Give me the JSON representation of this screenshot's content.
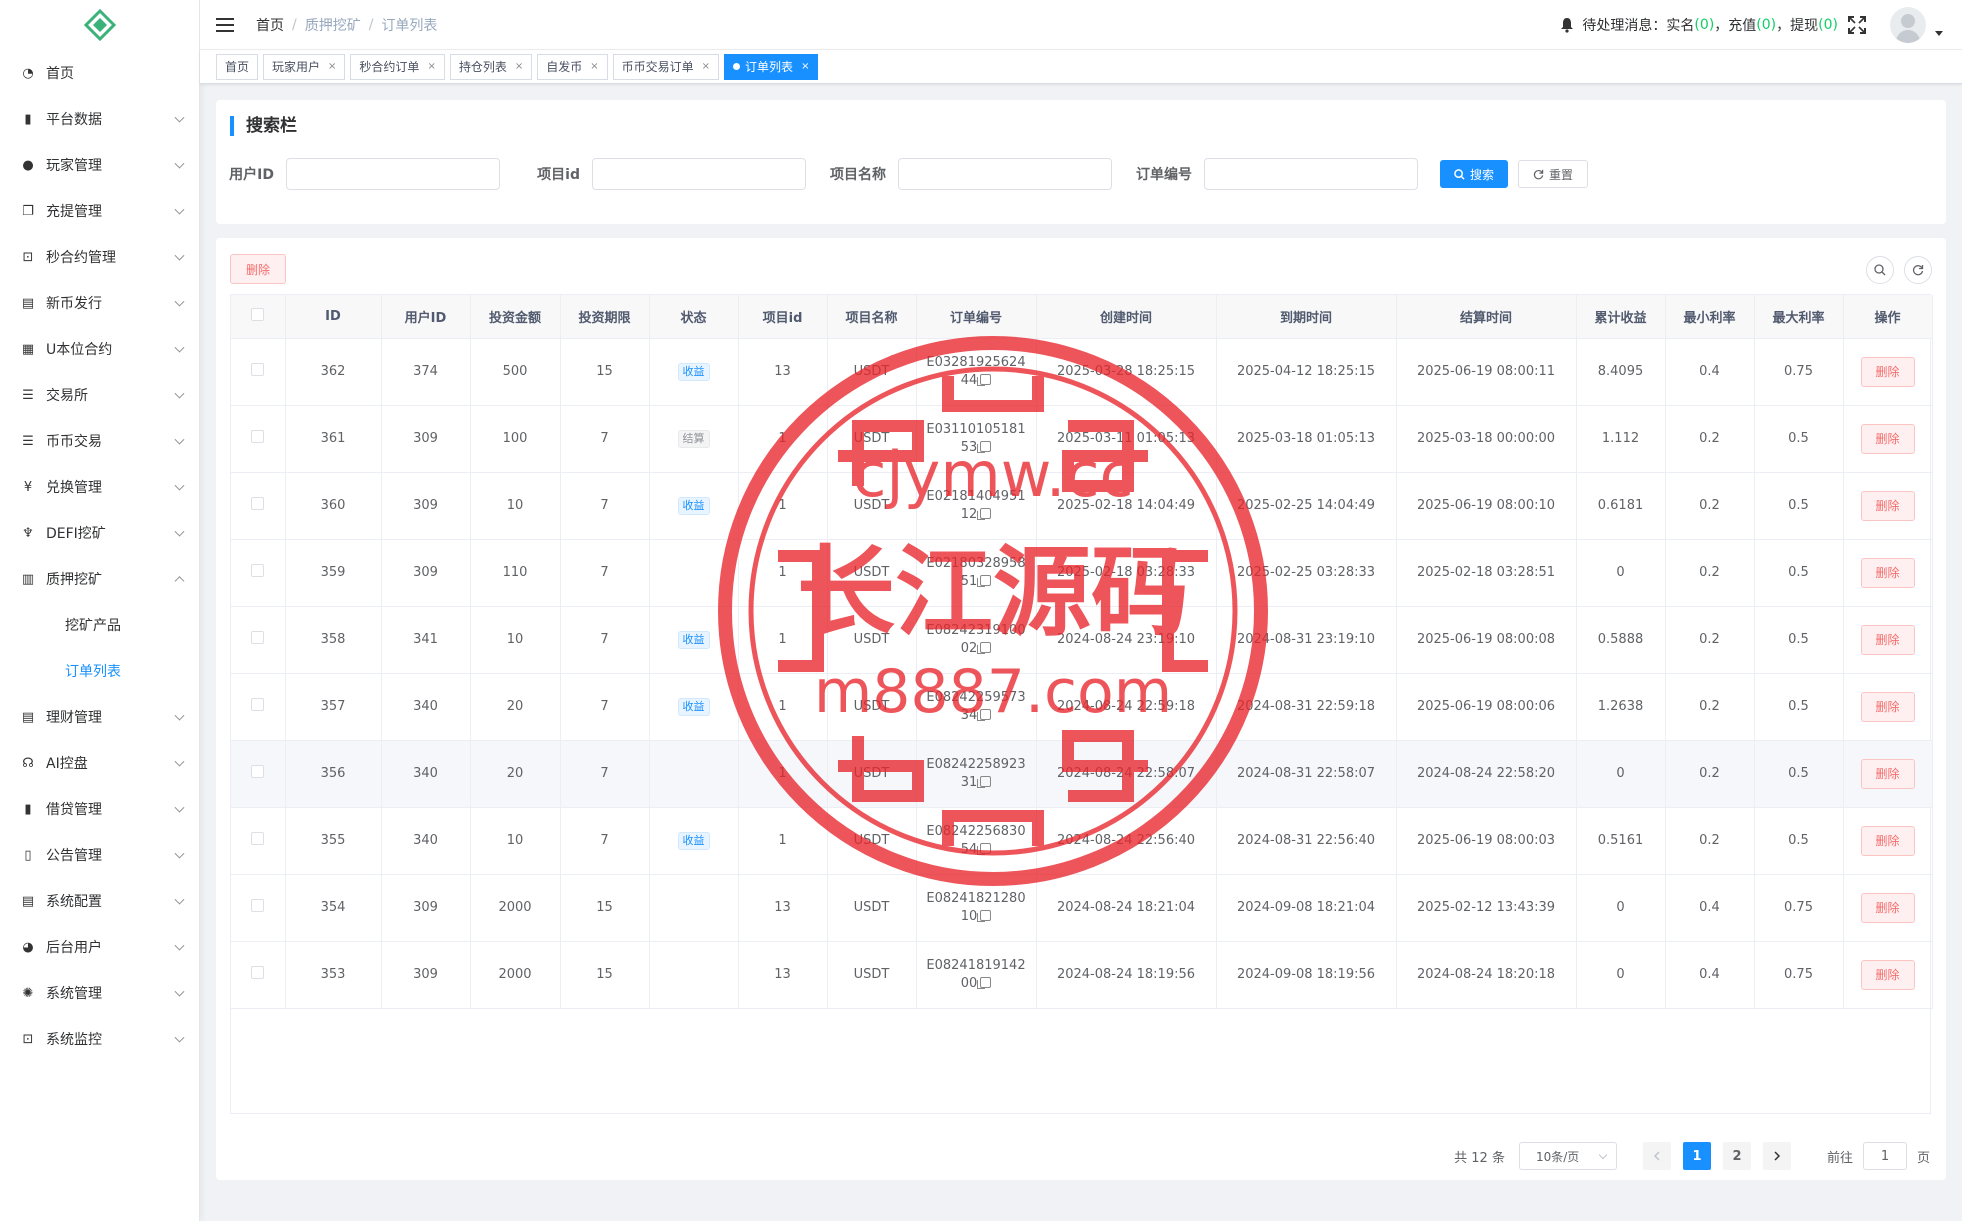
{
  "colors": {
    "primary": "#1890ff",
    "danger": "#f56c6c",
    "success": "#13ce66",
    "watermark": "#e8262c"
  },
  "sidebar": {
    "items": [
      {
        "label": "首页",
        "icon": "dashboard-icon"
      },
      {
        "label": "平台数据",
        "icon": "book-icon"
      },
      {
        "label": "玩家管理",
        "icon": "user-icon"
      },
      {
        "label": "充提管理",
        "icon": "copy-icon"
      },
      {
        "label": "秒合约管理",
        "icon": "chart-monitor-icon"
      },
      {
        "label": "新币发行",
        "icon": "coin-icon"
      },
      {
        "label": "U本位合约",
        "icon": "grid-icon"
      },
      {
        "label": "交易所",
        "icon": "list-icon"
      },
      {
        "label": "币币交易",
        "icon": "list-icon"
      },
      {
        "label": "兑换管理",
        "icon": "yen-icon"
      },
      {
        "label": "DEFI挖矿",
        "icon": "tree-icon"
      },
      {
        "label": "质押挖矿",
        "icon": "bar-chart-icon"
      },
      {
        "label": "理财管理",
        "icon": "document-icon"
      },
      {
        "label": "AI控盘",
        "icon": "robot-icon"
      },
      {
        "label": "借贷管理",
        "icon": "book-icon"
      },
      {
        "label": "公告管理",
        "icon": "open-book-icon"
      },
      {
        "label": "系统配置",
        "icon": "document-icon"
      },
      {
        "label": "后台用户",
        "icon": "users-icon"
      },
      {
        "label": "系统管理",
        "icon": "gear-icon"
      },
      {
        "label": "系统监控",
        "icon": "monitor-icon"
      }
    ],
    "sub_items": [
      "挖矿产品",
      "订单列表"
    ]
  },
  "header": {
    "breadcrumb": [
      "首页",
      "质押挖矿",
      "订单列表"
    ],
    "notice_label": "待处理消息：",
    "notice_realname": "实名",
    "notice_recharge": "充值",
    "notice_withdraw": "提现",
    "count_realname": "0",
    "count_recharge": "0",
    "count_withdraw": "0"
  },
  "tags": [
    "首页",
    "玩家用户",
    "秒合约订单",
    "持仓列表",
    "自发币",
    "币币交易订单",
    "订单列表"
  ],
  "search": {
    "title": "搜索栏",
    "fields": [
      "用户ID",
      "项目id",
      "项目名称",
      "订单编号"
    ],
    "search_btn": "搜索",
    "reset_btn": "重置"
  },
  "toolbar": {
    "delete_label": "删除"
  },
  "table": {
    "columns": [
      "ID",
      "用户ID",
      "投资金额",
      "投资期限",
      "状态",
      "项目id",
      "项目名称",
      "订单编号",
      "创建时间",
      "到期时间",
      "结算时间",
      "累计收益",
      "最小利率",
      "最大利率",
      "操作"
    ],
    "rows": [
      {
        "id": "362",
        "uid": "374",
        "amount": "500",
        "term": "15",
        "status": "收益",
        "status_type": "blue",
        "pid": "13",
        "pname": "USDT",
        "no1": "E03281925624",
        "no2": "44",
        "created": "2025-03-28 18:25:15",
        "due": "2025-04-12 18:25:15",
        "settled": "2025-06-19 08:00:11",
        "profit": "8.4095",
        "minr": "0.4",
        "maxr": "0.75",
        "op": "删除"
      },
      {
        "id": "361",
        "uid": "309",
        "amount": "100",
        "term": "7",
        "status": "结算",
        "status_type": "gray",
        "pid": "1",
        "pname": "USDT",
        "no1": "E03110105181",
        "no2": "53",
        "created": "2025-03-11 01:05:13",
        "due": "2025-03-18 01:05:13",
        "settled": "2025-03-18 00:00:00",
        "profit": "1.112",
        "minr": "0.2",
        "maxr": "0.5",
        "op": "删除"
      },
      {
        "id": "360",
        "uid": "309",
        "amount": "10",
        "term": "7",
        "status": "收益",
        "status_type": "blue",
        "pid": "1",
        "pname": "USDT",
        "no1": "E02181404951",
        "no2": "12",
        "created": "2025-02-18 14:04:49",
        "due": "2025-02-25 14:04:49",
        "settled": "2025-06-19 08:00:10",
        "profit": "0.6181",
        "minr": "0.2",
        "maxr": "0.5",
        "op": "删除"
      },
      {
        "id": "359",
        "uid": "309",
        "amount": "110",
        "term": "7",
        "status": "",
        "status_type": "",
        "pid": "1",
        "pname": "USDT",
        "no1": "E02180328958",
        "no2": "51",
        "created": "2025-02-18 03:28:33",
        "due": "2025-02-25 03:28:33",
        "settled": "2025-02-18 03:28:51",
        "profit": "0",
        "minr": "0.2",
        "maxr": "0.5",
        "op": "删除"
      },
      {
        "id": "358",
        "uid": "341",
        "amount": "10",
        "term": "7",
        "status": "收益",
        "status_type": "blue",
        "pid": "1",
        "pname": "USDT",
        "no1": "E08242319100",
        "no2": "02",
        "created": "2024-08-24 23:19:10",
        "due": "2024-08-31 23:19:10",
        "settled": "2025-06-19 08:00:08",
        "profit": "0.5888",
        "minr": "0.2",
        "maxr": "0.5",
        "op": "删除"
      },
      {
        "id": "357",
        "uid": "340",
        "amount": "20",
        "term": "7",
        "status": "收益",
        "status_type": "blue",
        "pid": "1",
        "pname": "USDT",
        "no1": "E08242259573",
        "no2": "34",
        "created": "2024-08-24 22:59:18",
        "due": "2024-08-31 22:59:18",
        "settled": "2025-06-19 08:00:06",
        "profit": "1.2638",
        "minr": "0.2",
        "maxr": "0.5",
        "op": "删除"
      },
      {
        "id": "356",
        "uid": "340",
        "amount": "20",
        "term": "7",
        "status": "",
        "status_type": "",
        "pid": "1",
        "pname": "USDT",
        "no1": "E08242258923",
        "no2": "31",
        "created": "2024-08-24 22:58:07",
        "due": "2024-08-31 22:58:07",
        "settled": "2024-08-24 22:58:20",
        "profit": "0",
        "minr": "0.2",
        "maxr": "0.5",
        "op": "删除"
      },
      {
        "id": "355",
        "uid": "340",
        "amount": "10",
        "term": "7",
        "status": "收益",
        "status_type": "blue",
        "pid": "1",
        "pname": "USDT",
        "no1": "E08242256830",
        "no2": "54",
        "created": "2024-08-24 22:56:40",
        "due": "2024-08-31 22:56:40",
        "settled": "2025-06-19 08:00:03",
        "profit": "0.5161",
        "minr": "0.2",
        "maxr": "0.5",
        "op": "删除"
      },
      {
        "id": "354",
        "uid": "309",
        "amount": "2000",
        "term": "15",
        "status": "",
        "status_type": "",
        "pid": "13",
        "pname": "USDT",
        "no1": "E08241821280",
        "no2": "10",
        "created": "2024-08-24 18:21:04",
        "due": "2024-09-08 18:21:04",
        "settled": "2025-02-12 13:43:39",
        "profit": "0",
        "minr": "0.4",
        "maxr": "0.75",
        "op": "删除"
      },
      {
        "id": "353",
        "uid": "309",
        "amount": "2000",
        "term": "15",
        "status": "",
        "status_type": "",
        "pid": "13",
        "pname": "USDT",
        "no1": "E08241819142",
        "no2": "00",
        "created": "2024-08-24 18:19:56",
        "due": "2024-09-08 18:19:56",
        "settled": "2024-08-24 18:20:18",
        "profit": "0",
        "minr": "0.4",
        "maxr": "0.75",
        "op": "删除"
      }
    ]
  },
  "pagination": {
    "total": "共 12 条",
    "page_size": "10条/页",
    "pages": [
      "1",
      "2"
    ],
    "current": "1",
    "goto_label": "前往",
    "goto_value": "1",
    "goto_unit": "页"
  },
  "watermark": {
    "line1": "cjymw.cc",
    "line2": "长江源码",
    "line3": "m8887.com"
  }
}
